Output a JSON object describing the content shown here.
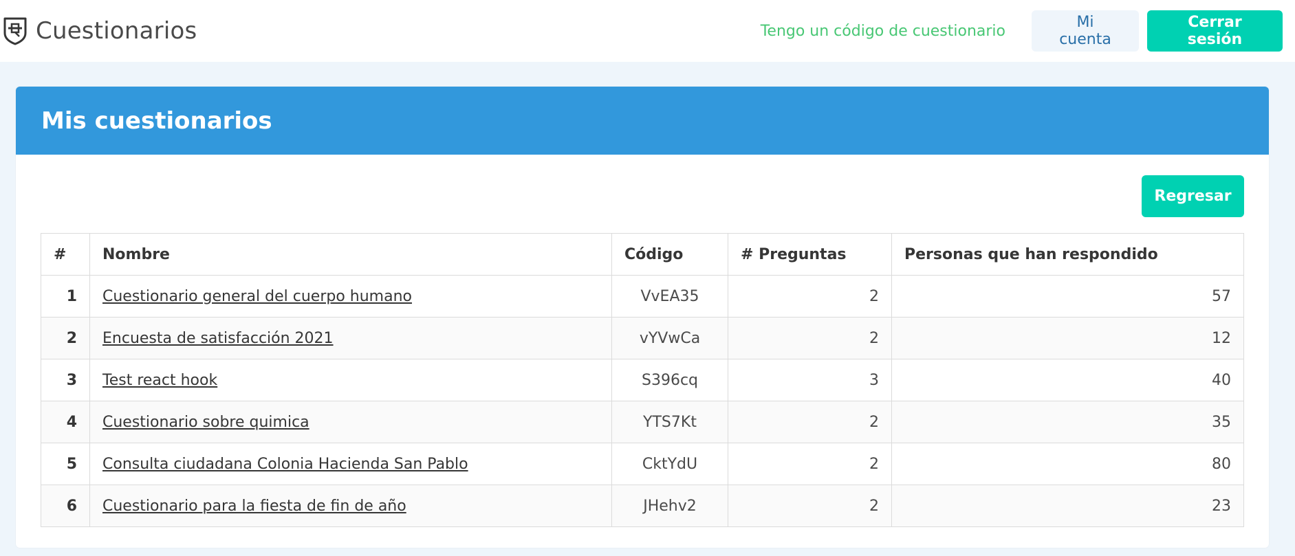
{
  "navbar": {
    "brand_icon": "shield-icon",
    "brand_title": "Cuestionarios",
    "code_link": "Tengo un código de cuestionario",
    "account_button": "Mi cuenta",
    "logout_button": "Cerrar sesión"
  },
  "card": {
    "title": "Mis cuestionarios",
    "back_button": "Regresar"
  },
  "table": {
    "headers": [
      "#",
      "Nombre",
      "Código",
      "# Preguntas",
      "Personas que han respondido"
    ],
    "rows": [
      {
        "num": "1",
        "name": "Cuestionario general del cuerpo humano",
        "code": "VvEA35",
        "questions": "2",
        "responses": "57"
      },
      {
        "num": "2",
        "name": "Encuesta de satisfacción 2021",
        "code": "vYVwCa",
        "questions": "2",
        "responses": "12"
      },
      {
        "num": "3",
        "name": "Test react hook",
        "code": "S396cq",
        "questions": "3",
        "responses": "40"
      },
      {
        "num": "4",
        "name": "Cuestionario sobre quimica",
        "code": "YTS7Kt",
        "questions": "2",
        "responses": "35"
      },
      {
        "num": "5",
        "name": "Consulta ciudadana Colonia Hacienda San Pablo",
        "code": "CktYdU",
        "questions": "2",
        "responses": "80"
      },
      {
        "num": "6",
        "name": "Cuestionario para la fiesta de fin de año",
        "code": "JHehv2",
        "questions": "2",
        "responses": "23"
      }
    ]
  },
  "colors": {
    "header_blue": "#3298dc",
    "primary_teal": "#00d1b2",
    "link_green": "#48c774",
    "light_button": "#eff5fb",
    "page_background": "#eef5fb"
  }
}
